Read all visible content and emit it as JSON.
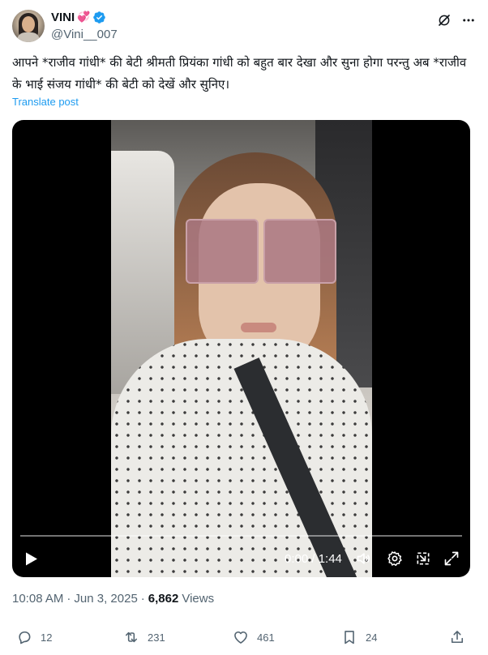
{
  "author": {
    "display_name": "VINI",
    "emoji": "💞",
    "handle": "@Vini__007"
  },
  "post": {
    "text": "आपने *राजीव गांधी* की बेटी श्रीमती प्रियंका गांधी को बहुत बार देखा और सुना होगा परन्तु अब *राजीव के भाई संजय गांधी* की बेटी को देखें और सुनिए।",
    "translate_label": "Translate post"
  },
  "video": {
    "time_label": "0:00 / 1:44",
    "progress": 0
  },
  "meta": {
    "time": "10:08 AM",
    "sep1": "·",
    "date": "Jun 3, 2025",
    "sep2": "·",
    "views": "6,862",
    "views_label": "Views"
  },
  "actions": {
    "replies": "12",
    "reposts": "231",
    "likes": "461",
    "bookmarks": "24"
  },
  "colors": {
    "accent": "#1d9bf0",
    "secondary_text": "#536471",
    "primary_text": "#0f1419"
  }
}
